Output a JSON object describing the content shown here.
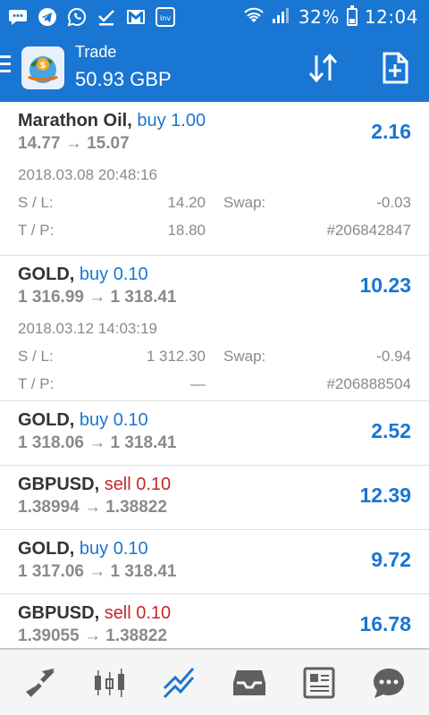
{
  "status_bar": {
    "battery": "32%",
    "time": "12:04",
    "icons": [
      "chat-bubble-icon",
      "telegram-icon",
      "whatsapp-icon",
      "check-icon",
      "gmail-icon",
      "investing-icon",
      "wifi-icon",
      "signal-icon",
      "battery-icon"
    ]
  },
  "header": {
    "title": "Trade",
    "balance": "50.93 GBP",
    "actions": [
      "sort-icon",
      "new-order-icon"
    ]
  },
  "positions": [
    {
      "symbol": "Marathon Oil,",
      "type": "buy 1.00",
      "direction": "buy",
      "prices": "14.77 → 15.07",
      "profit": "2.16",
      "expanded": true,
      "time": "2018.03.08 20:48:16",
      "sl_label": "S / L:",
      "sl": "14.20",
      "swap_label": "Swap:",
      "swap": "-0.03",
      "tp_label": "T / P:",
      "tp": "18.80",
      "ticket": "#206842847"
    },
    {
      "symbol": "GOLD,",
      "type": "buy 0.10",
      "direction": "buy",
      "prices": "1 316.99 → 1 318.41",
      "profit": "10.23",
      "expanded": true,
      "time": "2018.03.12 14:03:19",
      "sl_label": "S / L:",
      "sl": "1 312.30",
      "swap_label": "Swap:",
      "swap": "-0.94",
      "tp_label": "T / P:",
      "tp": "—",
      "ticket": "#206888504"
    },
    {
      "symbol": "GOLD,",
      "type": "buy 0.10",
      "direction": "buy",
      "prices": "1 318.06 → 1 318.41",
      "profit": "2.52",
      "expanded": false
    },
    {
      "symbol": "GBPUSD,",
      "type": "sell 0.10",
      "direction": "sell",
      "prices": "1.38994 → 1.38822",
      "profit": "12.39",
      "expanded": false
    },
    {
      "symbol": "GOLD,",
      "type": "buy 0.10",
      "direction": "buy",
      "prices": "1 317.06 → 1 318.41",
      "profit": "9.72",
      "expanded": false
    },
    {
      "symbol": "GBPUSD,",
      "type": "sell 0.10",
      "direction": "sell",
      "prices": "1.39055 → 1.38822",
      "profit": "16.78",
      "expanded": false
    }
  ],
  "bottom_nav": {
    "items": [
      "quotes-arrows-icon",
      "candlestick-chart-icon",
      "trade-chart-icon",
      "inbox-icon",
      "news-icon",
      "chat-icon"
    ],
    "active": "trade-chart-icon"
  },
  "colors": {
    "primary": "#1976d2",
    "sell": "#c62828",
    "muted": "#8a8a8a",
    "text": "#333333",
    "inactive_icon": "#5f5f5f"
  }
}
